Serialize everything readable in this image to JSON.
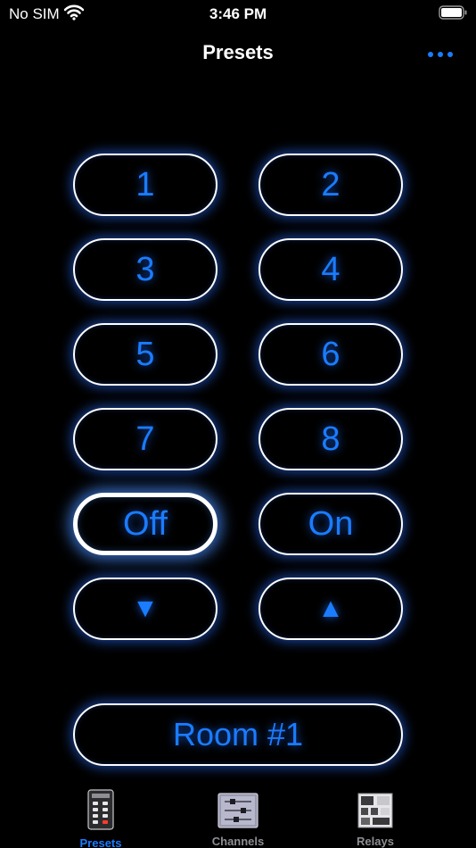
{
  "status_bar": {
    "carrier": "No SIM",
    "time": "3:46 PM"
  },
  "nav": {
    "title": "Presets",
    "more_icon": "ellipsis-icon"
  },
  "presets": {
    "buttons": [
      {
        "label": "1"
      },
      {
        "label": "2"
      },
      {
        "label": "3"
      },
      {
        "label": "4"
      },
      {
        "label": "5"
      },
      {
        "label": "6"
      },
      {
        "label": "7"
      },
      {
        "label": "8"
      },
      {
        "label": "Off",
        "selected": true
      },
      {
        "label": "On"
      },
      {
        "label": "▼"
      },
      {
        "label": "▲"
      }
    ],
    "room": "Room #1"
  },
  "colors": {
    "accent": "#1a7cff",
    "background": "#000000",
    "border": "#ffffff",
    "inactive_tab": "#8e8e93"
  },
  "tabs": [
    {
      "label": "Presets",
      "icon": "keypad-icon",
      "active": true
    },
    {
      "label": "Channels",
      "icon": "sliders-icon",
      "active": false
    },
    {
      "label": "Relays",
      "icon": "relay-panel-icon",
      "active": false
    }
  ]
}
